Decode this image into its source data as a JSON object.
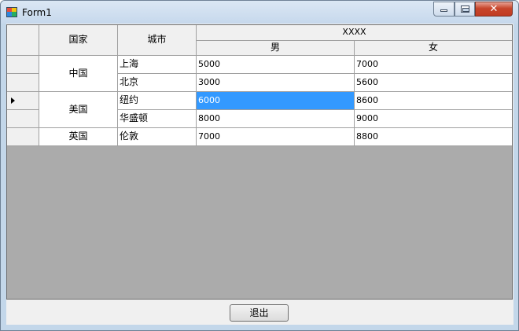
{
  "window": {
    "title": "Form1",
    "close_glyph": "✕"
  },
  "grid": {
    "headers": {
      "country": "国家",
      "city": "城市",
      "group": "XXXX",
      "male": "男",
      "female": "女"
    },
    "countries": [
      "中国",
      "美国",
      "英国"
    ],
    "rows": [
      {
        "city": "上海",
        "male": "5000",
        "female": "7000"
      },
      {
        "city": "北京",
        "male": "3000",
        "female": "5600"
      },
      {
        "city": "纽约",
        "male": "6000",
        "female": "8600"
      },
      {
        "city": "华盛顿",
        "male": "8000",
        "female": "9000"
      },
      {
        "city": "伦敦",
        "male": "7000",
        "female": "8800"
      }
    ],
    "selection_color": "#3399ff"
  },
  "footer": {
    "exit_label": "退出"
  }
}
